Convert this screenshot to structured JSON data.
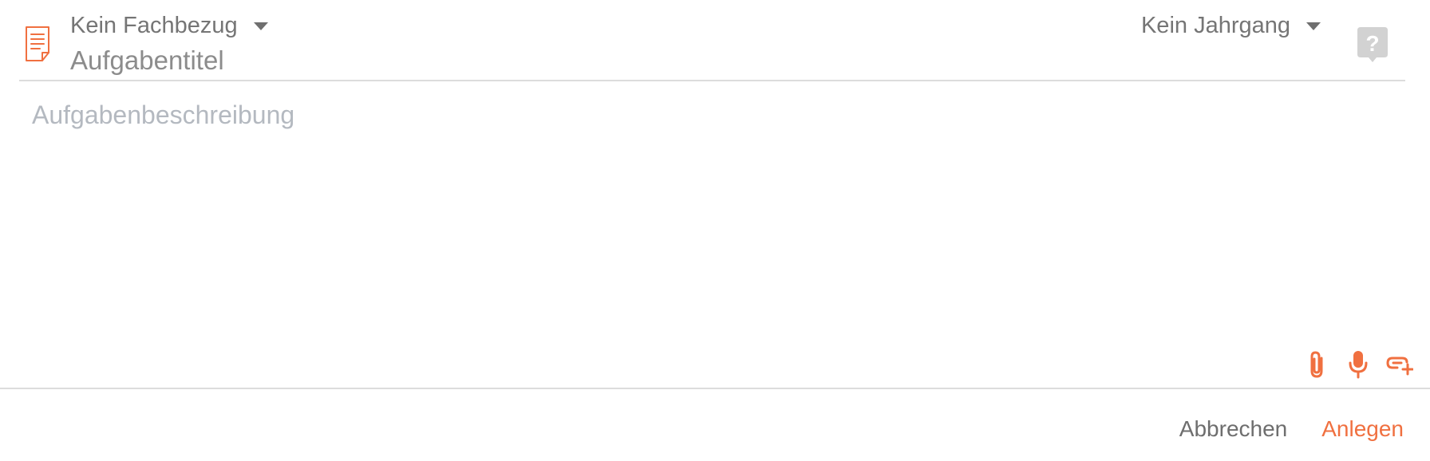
{
  "header": {
    "subject_dropdown": {
      "label": "Kein Fachbezug",
      "icon": "chevron-down-icon"
    },
    "title_field": {
      "placeholder": "Aufgabentitel",
      "value": ""
    },
    "year_dropdown": {
      "label": "Kein Jahrgang",
      "icon": "chevron-down-icon"
    },
    "help_icon": "question-icon",
    "task_icon": "document-icon"
  },
  "body": {
    "description_field": {
      "placeholder": "Aufgabenbeschreibung",
      "value": ""
    }
  },
  "toolbar": {
    "items": [
      {
        "icon": "paperclip-icon"
      },
      {
        "icon": "microphone-icon"
      },
      {
        "icon": "add-link-icon"
      }
    ]
  },
  "footer": {
    "cancel_label": "Abbrechen",
    "create_label": "Anlegen"
  },
  "colors": {
    "accent": "#f07040",
    "text": "#757575",
    "placeholder": "#b4b9c0",
    "divider": "#dcdcdc",
    "help_icon": "#d2d2d2"
  }
}
